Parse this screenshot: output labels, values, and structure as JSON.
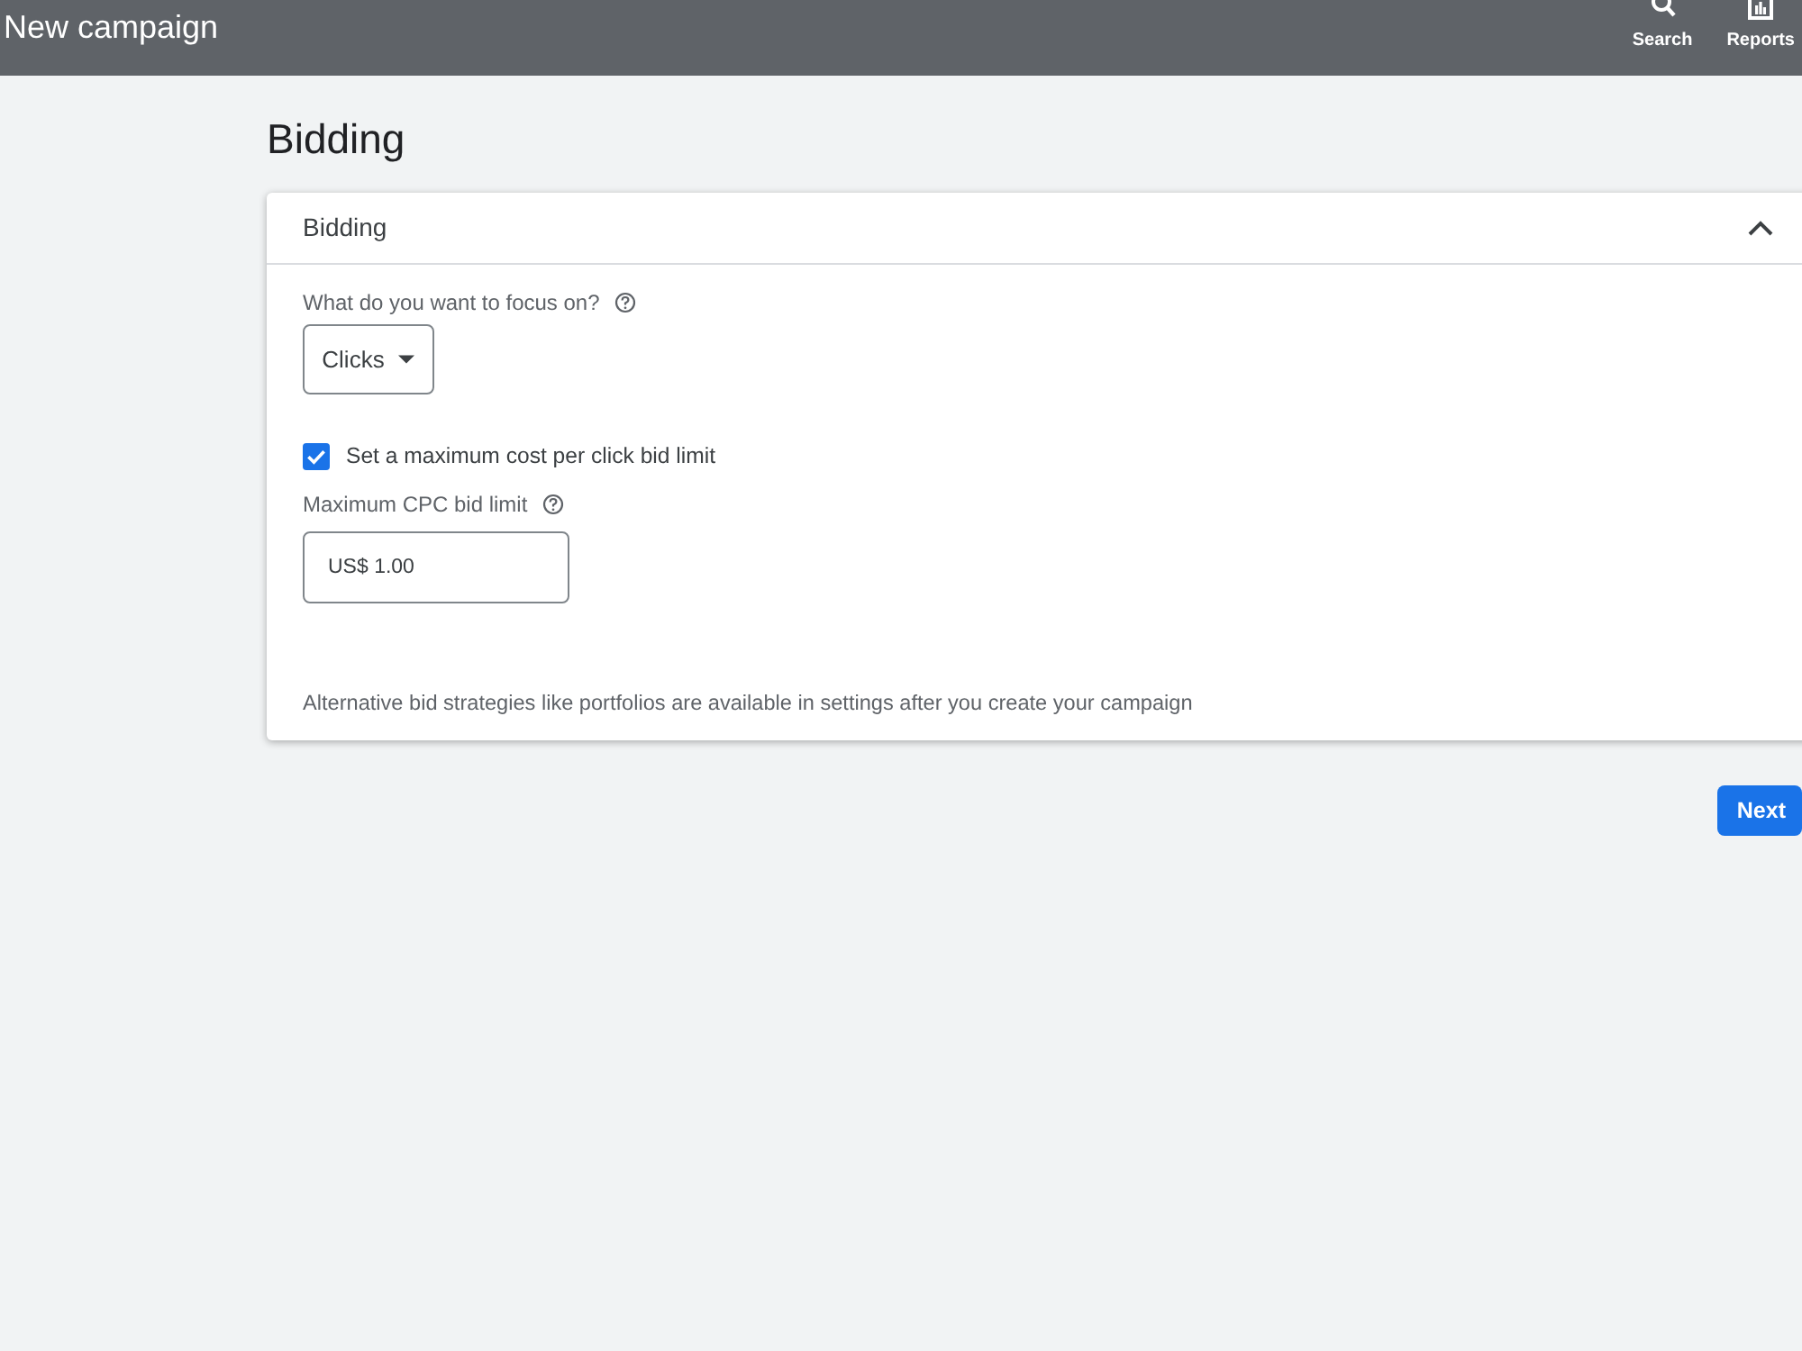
{
  "app_bar": {
    "title": "New campaign",
    "actions": [
      {
        "label": "Search",
        "kind": "search"
      },
      {
        "label": "Reports",
        "kind": "reports"
      }
    ]
  },
  "page": {
    "heading": "Bidding"
  },
  "card": {
    "title": "Bidding",
    "expanded": true,
    "focus": {
      "label": "What do you want to focus on?",
      "value": "Clicks"
    },
    "bid_limit": {
      "label": "Set a maximum cost per click bid limit",
      "checked": true
    },
    "max_cpc": {
      "label": "Maximum CPC bid limit",
      "value": "US$ 1.00"
    },
    "note": "Alternative bid strategies like portfolios are available in settings after you create your campaign"
  },
  "buttons": [
    {
      "label": "Next"
    }
  ]
}
